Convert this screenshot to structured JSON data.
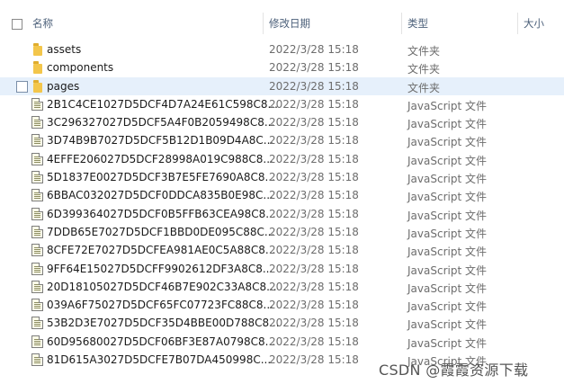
{
  "header": {
    "name": "名称",
    "date": "修改日期",
    "type": "类型",
    "size": "大小"
  },
  "rows": [
    {
      "name": "assets",
      "date": "2022/3/28 15:18",
      "type": "文件夹",
      "icon": "folder-icon"
    },
    {
      "name": "components",
      "date": "2022/3/28 15:18",
      "type": "文件夹",
      "icon": "folder-icon"
    },
    {
      "name": "pages",
      "date": "2022/3/28 15:18",
      "type": "文件夹",
      "icon": "folder-icon",
      "selected": true
    },
    {
      "name": "2B1C4CE1027D5DCF4D7A24E61C598C8...",
      "date": "2022/3/28 15:18",
      "type": "JavaScript 文件",
      "icon": "js-file-icon"
    },
    {
      "name": "3C296327027D5DCF5A4F0B2059498C8...",
      "date": "2022/3/28 15:18",
      "type": "JavaScript 文件",
      "icon": "js-file-icon"
    },
    {
      "name": "3D74B9B7027D5DCF5B12D1B09D4A8C...",
      "date": "2022/3/28 15:18",
      "type": "JavaScript 文件",
      "icon": "js-file-icon"
    },
    {
      "name": "4EFFE206027D5DCF28998A019C988C8...",
      "date": "2022/3/28 15:18",
      "type": "JavaScript 文件",
      "icon": "js-file-icon"
    },
    {
      "name": "5D1837E0027D5DCF3B7E5FE7690A8C8...",
      "date": "2022/3/28 15:18",
      "type": "JavaScript 文件",
      "icon": "js-file-icon"
    },
    {
      "name": "6BBAC032027D5DCF0DDCA835B0E98C...",
      "date": "2022/3/28 15:18",
      "type": "JavaScript 文件",
      "icon": "js-file-icon"
    },
    {
      "name": "6D399364027D5DCF0B5FFB63CEA98C8...",
      "date": "2022/3/28 15:18",
      "type": "JavaScript 文件",
      "icon": "js-file-icon"
    },
    {
      "name": "7DDB65E7027D5DCF1BBD0DE095C88C...",
      "date": "2022/3/28 15:18",
      "type": "JavaScript 文件",
      "icon": "js-file-icon"
    },
    {
      "name": "8CFE72E7027D5DCFEA981AE0C5A88C8...",
      "date": "2022/3/28 15:18",
      "type": "JavaScript 文件",
      "icon": "js-file-icon"
    },
    {
      "name": "9FF64E15027D5DCFF9902612DF3A8C8...",
      "date": "2022/3/28 15:18",
      "type": "JavaScript 文件",
      "icon": "js-file-icon"
    },
    {
      "name": "20D18105027D5DCF46B7E902C33A8C8...",
      "date": "2022/3/28 15:18",
      "type": "JavaScript 文件",
      "icon": "js-file-icon"
    },
    {
      "name": "039A6F75027D5DCF65FC07723FC88C8...",
      "date": "2022/3/28 15:18",
      "type": "JavaScript 文件",
      "icon": "js-file-icon"
    },
    {
      "name": "53B2D3E7027D5DCF35D4BBE00D788C8...",
      "date": "2022/3/28 15:18",
      "type": "JavaScript 文件",
      "icon": "js-file-icon"
    },
    {
      "name": "60D95680027D5DCF06BF3E87A0798C8...",
      "date": "2022/3/28 15:18",
      "type": "JavaScript 文件",
      "icon": "js-file-icon"
    },
    {
      "name": "81D615A3027D5DCFE7B07DA450998C...",
      "date": "2022/3/28 15:18",
      "type": "JavaScript 文件",
      "icon": "js-file-icon"
    }
  ],
  "watermark": "CSDN @霞霞资源下载"
}
